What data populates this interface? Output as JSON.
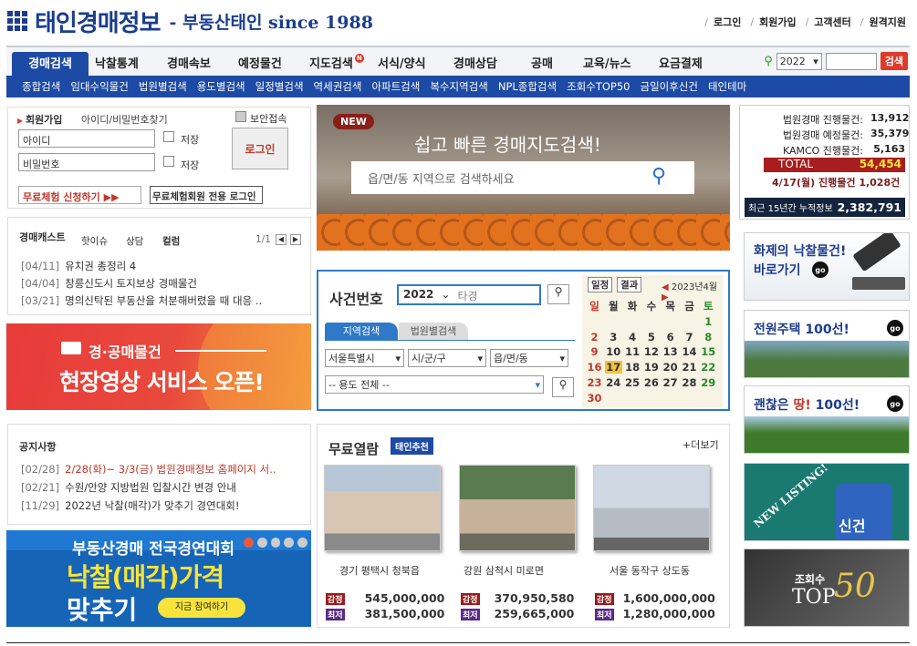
{
  "header": {
    "title": "태인경매정보",
    "subtitle": "- 부동산태인 since 1988",
    "links": [
      "로그인",
      "회원가입",
      "고객센터",
      "원격지원"
    ]
  },
  "nav": {
    "items": [
      "경매검색",
      "낙찰통계",
      "경매속보",
      "예정물건",
      "지도검색",
      "서식/양식",
      "경매상담",
      "공매",
      "교육/뉴스",
      "요금결제"
    ],
    "badge": "N"
  },
  "subnav": [
    "종합검색",
    "임대수익물건",
    "법원별검색",
    "용도별검색",
    "일정별검색",
    "역세권검색",
    "아파트검색",
    "복수지역검색",
    "NPL종합검색",
    "조회수TOP50",
    "금일이후신건",
    "태인테마"
  ],
  "search": {
    "year": "2022",
    "button": "검색"
  },
  "login": {
    "title": "회원가입",
    "find": "아이디/비밀번호찾기",
    "secure": "보안접속",
    "id_ph": "아이디",
    "pw_ph": "비밀번호",
    "save": "저장",
    "button": "로그인",
    "trial": "무료체험 신청하기 ▶▶",
    "trial_login": "무료체험회원 전용 로그인"
  },
  "cast": {
    "title": "경매캐스트",
    "tabs": [
      "핫이슈",
      "상담",
      "컬럼"
    ],
    "page": "1/1",
    "items": [
      {
        "date": "[04/11]",
        "text": "유치권 총정리 4"
      },
      {
        "date": "[04/04]",
        "text": "창릉신도시 토지보상 경매물건"
      },
      {
        "date": "[03/21]",
        "text": "명의신탁된 부동산을 처분해버렸을 때 대응 .."
      }
    ]
  },
  "video": {
    "line1": "경·공매물건",
    "line2": "현장영상 서비스 오픈!"
  },
  "notice": {
    "title": "공지사항",
    "items": [
      {
        "date": "[02/28]",
        "text": "2/28(화)~ 3/3(금) 법원경매정보 홈페이지 서.."
      },
      {
        "date": "[02/21]",
        "text": "수원/안양 지방법원 입찰시간 변경 안내"
      },
      {
        "date": "[11/29]",
        "text": "2022년 낙찰(매각)가 맞추기 경연대회!"
      }
    ]
  },
  "contest": {
    "line1": "부동산경매 전국경연대회",
    "line2": "낙찰(매각)가격",
    "line3": "맞추기",
    "button": "지금 참여하기"
  },
  "map": {
    "new": "NEW",
    "title": "쉽고 빠른 경매지도검색!",
    "placeholder": "읍/면/동 지역으로 검색하세요"
  },
  "case": {
    "title": "사건번호",
    "year": "2022",
    "ph": "타경",
    "tabs": [
      "지역검색",
      "법원별검색"
    ],
    "sido": "서울특별시",
    "sigungu": "시/군/구",
    "dong": "읍/면/동",
    "use": "-- 용도 전체 --"
  },
  "calendar": {
    "tabs": [
      "일정",
      "결과"
    ],
    "month": "2023년4월",
    "weekdays": [
      "일",
      "월",
      "화",
      "수",
      "목",
      "금",
      "토"
    ],
    "rows": [
      [
        "",
        "",
        "",
        "",
        "",
        "",
        "1"
      ],
      [
        "2",
        "3",
        "4",
        "5",
        "6",
        "7",
        "8"
      ],
      [
        "9",
        "10",
        "11",
        "12",
        "13",
        "14",
        "15"
      ],
      [
        "16",
        "17",
        "18",
        "19",
        "20",
        "21",
        "22"
      ],
      [
        "23",
        "24",
        "25",
        "26",
        "27",
        "28",
        "29"
      ],
      [
        "30",
        "",
        "",
        "",
        "",
        "",
        ""
      ]
    ],
    "today": "17"
  },
  "free": {
    "title": "무료열람",
    "badge": "태인추천",
    "more": "+더보기",
    "items": [
      {
        "name": "경기 평택시 청북읍",
        "appraise": "545,000,000",
        "min": "381,500,000"
      },
      {
        "name": "강원 삼척시 미로면",
        "appraise": "370,950,580",
        "min": "259,665,000"
      },
      {
        "name": "서울 동작구 상도동",
        "appraise": "1,600,000,000",
        "min": "1,280,000,000"
      }
    ],
    "tag_appraise": "감정",
    "tag_min": "최저"
  },
  "stats": {
    "rows": [
      {
        "label": "법원경매 진행물건:",
        "value": "13,912"
      },
      {
        "label": "법원경매 예정물건:",
        "value": "35,379"
      },
      {
        "label": "KAMCO 진행물건:",
        "value": "5,163"
      }
    ],
    "total_label": "TOTAL",
    "total_value": "54,454",
    "date_label": "4/17(월) 진행물건",
    "date_value": "1,028건",
    "cum_label": "최근 15년간 누적정보",
    "cum_value": "2,382,791"
  },
  "right": {
    "hot": [
      "화제의 낙찰물건!",
      "바로가기"
    ],
    "house": "전원주택 100선!",
    "land_a": "괜찮은 ",
    "land_b": "땅!",
    "land_c": " 100선!",
    "new_listing": "NEW LISTING!",
    "new_label": "신건",
    "top_a": "조회수",
    "top_b": "TOP",
    "top_c": "50",
    "go": "go"
  }
}
